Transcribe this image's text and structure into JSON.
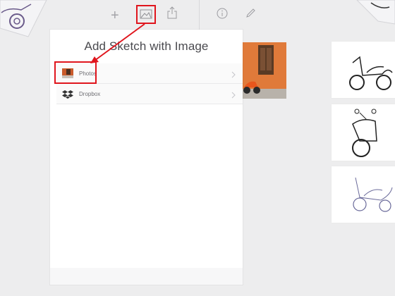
{
  "popover": {
    "title": "Add Sketch with Image",
    "items": [
      {
        "label": "Photos",
        "icon": "photos-thumbnail-icon"
      },
      {
        "label": "Dropbox",
        "icon": "dropbox-icon"
      }
    ]
  },
  "toolbar": {
    "icons": [
      "plus-icon",
      "image-icon",
      "share-icon",
      "info-icon",
      "pencil-icon"
    ]
  },
  "colors": {
    "highlight": "#e0151d",
    "background": "#ededee",
    "photo_accent": "#e07a3a"
  }
}
